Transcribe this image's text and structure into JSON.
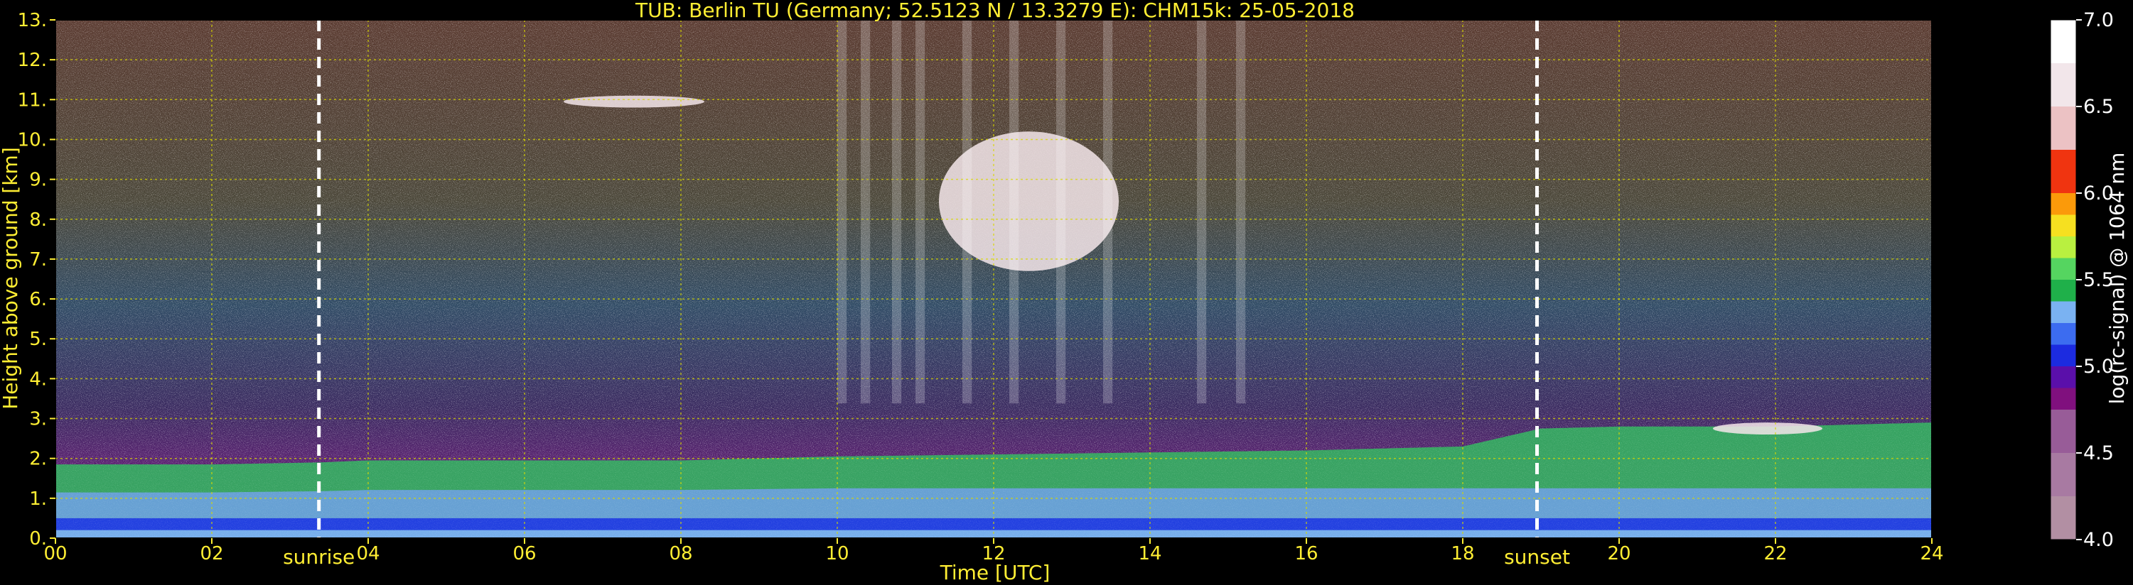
{
  "chart_data": {
    "type": "heatmap",
    "title": "TUB: Berlin TU (Germany; 52.5123 N / 13.3279 E):    CHM15k: 25-05-2018",
    "xlabel": "Time [UTC]",
    "ylabel": "Height above ground [km]",
    "xlim": [
      0,
      24
    ],
    "ylim": [
      0,
      13
    ],
    "x_ticks": [
      "00",
      "02",
      "04",
      "06",
      "08",
      "10",
      "12",
      "14",
      "16",
      "18",
      "20",
      "22",
      "24"
    ],
    "y_ticks": [
      "0.",
      "1.",
      "2.",
      "3.",
      "4.",
      "5.",
      "6.",
      "7.",
      "8.",
      "9.",
      "10.",
      "11.",
      "12.",
      "13."
    ],
    "grid": true,
    "events": [
      {
        "label": "sunrise",
        "time": 3.37
      },
      {
        "label": "sunset",
        "time": 18.95
      }
    ],
    "colorbar": {
      "label": "log(rc-signal) @ 1064 nm",
      "range": [
        4.0,
        7.0
      ],
      "ticks": [
        "4.0",
        "4.5",
        "5.0",
        "5.5",
        "6.0",
        "6.5",
        "7.0"
      ],
      "levels": [
        {
          "value": 4.0,
          "color": "#b28fa3"
        },
        {
          "value": 4.25,
          "color": "#a87aa2"
        },
        {
          "value": 4.5,
          "color": "#985c98"
        },
        {
          "value": 4.75,
          "color": "#80107e"
        },
        {
          "value": 4.875,
          "color": "#5a0faa"
        },
        {
          "value": 5.0,
          "color": "#1c2be0"
        },
        {
          "value": 5.125,
          "color": "#3c6cf0"
        },
        {
          "value": 5.25,
          "color": "#7ab2f2"
        },
        {
          "value": 5.375,
          "color": "#1fb04a"
        },
        {
          "value": 5.5,
          "color": "#55d560"
        },
        {
          "value": 5.625,
          "color": "#b9f040"
        },
        {
          "value": 5.75,
          "color": "#f6e020"
        },
        {
          "value": 5.875,
          "color": "#fb9a0a"
        },
        {
          "value": 6.0,
          "color": "#f03410"
        },
        {
          "value": 6.25,
          "color": "#ecc2c4"
        },
        {
          "value": 6.5,
          "color": "#f2e6ea"
        },
        {
          "value": 6.75,
          "color": "#ffffff"
        }
      ]
    },
    "boundary_layer_top_km": [
      [
        0,
        1.85
      ],
      [
        2,
        1.85
      ],
      [
        3.4,
        1.9
      ],
      [
        4,
        1.95
      ],
      [
        6,
        1.95
      ],
      [
        8,
        1.95
      ],
      [
        10,
        2.05
      ],
      [
        12,
        2.1
      ],
      [
        14,
        2.15
      ],
      [
        16,
        2.2
      ],
      [
        18,
        2.3
      ],
      [
        19,
        2.75
      ],
      [
        20,
        2.8
      ],
      [
        22,
        2.8
      ],
      [
        24,
        2.9
      ]
    ],
    "cloud_features": [
      {
        "t0": 6.5,
        "t1": 8.3,
        "h0": 10.8,
        "h1": 11.1
      },
      {
        "t0": 11.3,
        "t1": 13.6,
        "h0": 6.7,
        "h1": 10.2
      },
      {
        "t0": 21.2,
        "t1": 22.6,
        "h0": 2.6,
        "h1": 2.9
      }
    ]
  }
}
